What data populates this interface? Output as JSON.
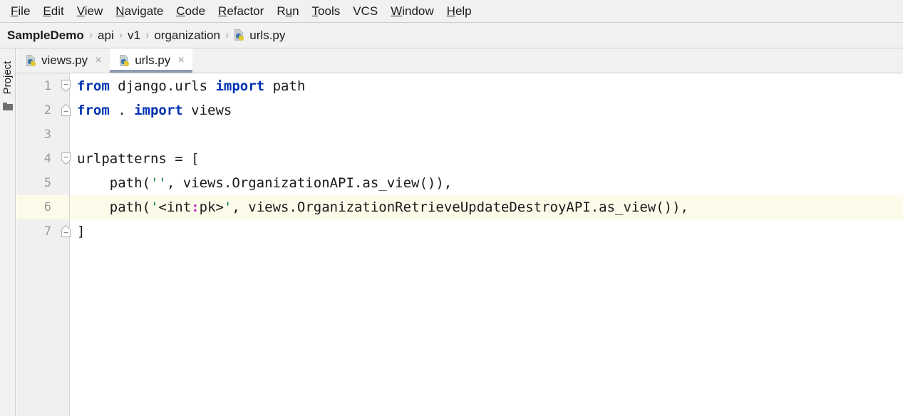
{
  "menubar": {
    "items": [
      {
        "label": "File",
        "mnemonic_index": 0
      },
      {
        "label": "Edit",
        "mnemonic_index": 0
      },
      {
        "label": "View",
        "mnemonic_index": 0
      },
      {
        "label": "Navigate",
        "mnemonic_index": 0
      },
      {
        "label": "Code",
        "mnemonic_index": 0
      },
      {
        "label": "Refactor",
        "mnemonic_index": 0
      },
      {
        "label": "Run",
        "mnemonic_index": 1
      },
      {
        "label": "Tools",
        "mnemonic_index": 0
      },
      {
        "label": "VCS",
        "mnemonic_index": -1
      },
      {
        "label": "Window",
        "mnemonic_index": 0
      },
      {
        "label": "Help",
        "mnemonic_index": 0
      }
    ]
  },
  "breadcrumb": {
    "separator": "›",
    "items": [
      {
        "label": "SampleDemo",
        "bold": true,
        "icon": ""
      },
      {
        "label": "api",
        "bold": false,
        "icon": ""
      },
      {
        "label": "v1",
        "bold": false,
        "icon": ""
      },
      {
        "label": "organization",
        "bold": false,
        "icon": ""
      },
      {
        "label": "urls.py",
        "bold": false,
        "icon": "python-file-icon"
      }
    ]
  },
  "tool_strip": {
    "project_label": "Project",
    "folder_icon": "folder-icon"
  },
  "tabs": {
    "close_glyph": "×",
    "items": [
      {
        "label": "views.py",
        "icon": "python-file-icon",
        "active": false
      },
      {
        "label": "urls.py",
        "icon": "python-file-icon",
        "active": true
      }
    ]
  },
  "editor": {
    "file": "urls.py",
    "current_line": 6,
    "current_line_color": "#fcfbe9",
    "keyword_color": "#0033b3",
    "string_color": "#157d3a",
    "separator_color": "#b52dbd",
    "text_color": "#1a1a1a",
    "gutter_color": "#f0f0f0",
    "line_number_color": "#999999",
    "lines": [
      {
        "number": 1,
        "fold": "collapse-down",
        "tokens": [
          {
            "text": "from",
            "type": "kw"
          },
          {
            "text": " django.urls ",
            "type": "plain"
          },
          {
            "text": "import",
            "type": "kw"
          },
          {
            "text": " path",
            "type": "plain"
          }
        ]
      },
      {
        "number": 2,
        "fold": "collapse-up",
        "tokens": [
          {
            "text": "from",
            "type": "kw"
          },
          {
            "text": " . ",
            "type": "plain"
          },
          {
            "text": "import",
            "type": "kw"
          },
          {
            "text": " views",
            "type": "plain"
          }
        ]
      },
      {
        "number": 3,
        "fold": "",
        "tokens": []
      },
      {
        "number": 4,
        "fold": "collapse-down",
        "tokens": [
          {
            "text": "urlpatterns = [",
            "type": "plain"
          }
        ]
      },
      {
        "number": 5,
        "fold": "",
        "tokens": [
          {
            "text": "    path(",
            "type": "plain"
          },
          {
            "text": "''",
            "type": "str"
          },
          {
            "text": ", views.OrganizationAPI.as_view()),",
            "type": "plain"
          }
        ]
      },
      {
        "number": 6,
        "fold": "",
        "tokens": [
          {
            "text": "    path(",
            "type": "plain"
          },
          {
            "text": "'",
            "type": "str"
          },
          {
            "text": "<int",
            "type": "plain"
          },
          {
            "text": ":",
            "type": "sep"
          },
          {
            "text": "pk>",
            "type": "plain"
          },
          {
            "text": "'",
            "type": "str"
          },
          {
            "text": ", views.OrganizationRetrieveUpdateDestroyAPI.as_view()),",
            "type": "plain"
          }
        ]
      },
      {
        "number": 7,
        "fold": "collapse-up",
        "tokens": [
          {
            "text": "]",
            "type": "plain"
          }
        ]
      }
    ]
  }
}
